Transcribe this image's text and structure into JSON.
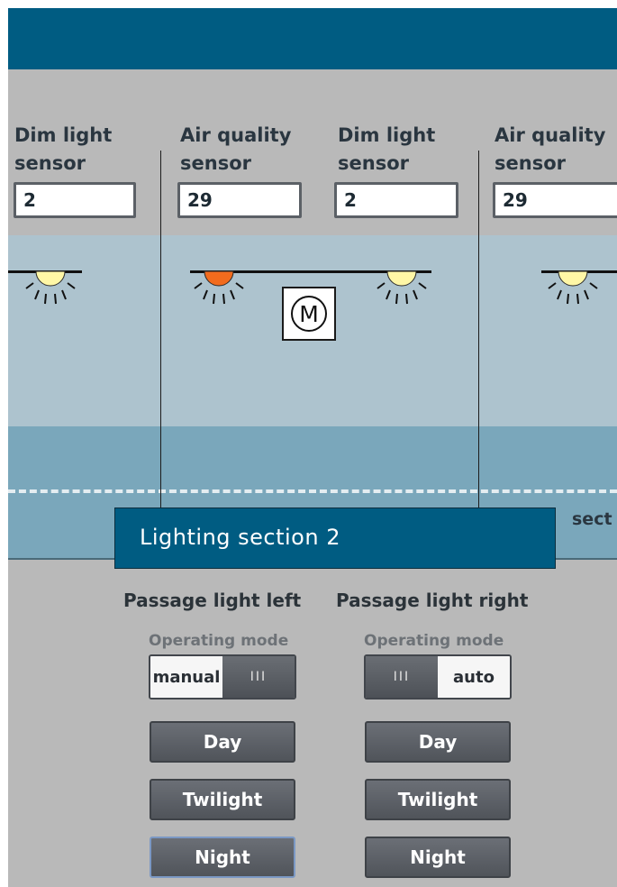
{
  "sensors": [
    {
      "label": "Dim light\nsensor",
      "value": "2"
    },
    {
      "label": "Air quality\nsensor",
      "value": "29"
    },
    {
      "label": "Dim light\nsensor",
      "value": "2"
    },
    {
      "label": "Air quality\nsensor",
      "value": "29"
    }
  ],
  "lamps": [
    {
      "state": "on",
      "color": "#fff7a6"
    },
    {
      "state": "fault",
      "color": "#f26b1d"
    },
    {
      "state": "on",
      "color": "#fff7a6"
    },
    {
      "state": "on",
      "color": "#fff7a6"
    }
  ],
  "motor": {
    "symbol": "M"
  },
  "section": {
    "title": "Lighting section 2",
    "next_partial": "sect"
  },
  "left": {
    "title": "Passage light left",
    "op_label": "Operating mode",
    "mode": "manual",
    "knob": "III",
    "buttons": {
      "day": "Day",
      "twilight": "Twilight",
      "night": "Night"
    }
  },
  "right": {
    "title": "Passage light right",
    "op_label": "Operating mode",
    "mode": "auto",
    "knob": "III",
    "buttons": {
      "day": "Day",
      "twilight": "Twilight",
      "night": "Night"
    }
  },
  "colors": {
    "brand": "#005c82",
    "panel": "#b9b9b9",
    "room": "#adc3ce",
    "floor": "#7aa7bb",
    "lamp_fault": "#f26b1d",
    "lamp_on": "#fff7a6"
  }
}
